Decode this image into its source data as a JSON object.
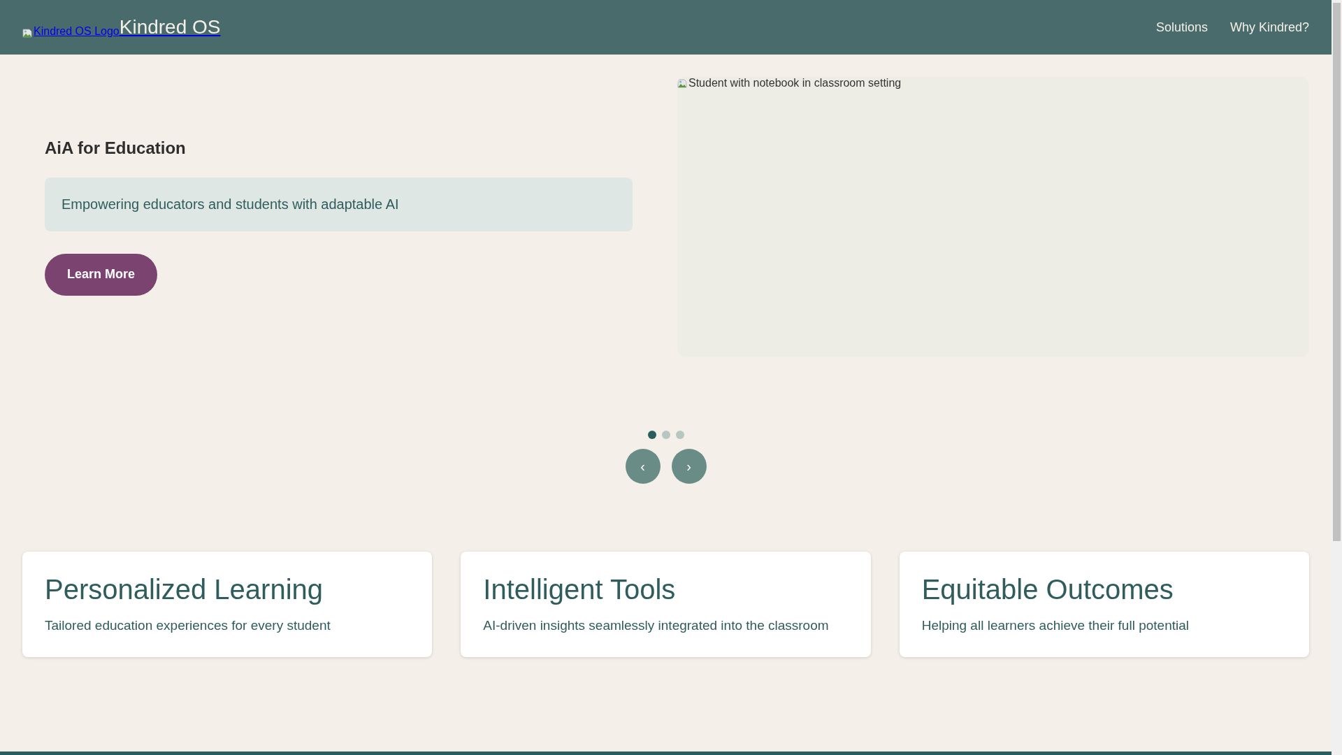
{
  "header": {
    "logo_alt": "Kindred OS Logo",
    "brand": "Kindred OS",
    "nav": [
      "Solutions",
      "Why Kindred?"
    ]
  },
  "hero": {
    "title": "AiA for Education",
    "subtitle": "Empowering educators and students with adaptable AI",
    "button": "Learn More",
    "image_alt": "Student with notebook in classroom setting"
  },
  "carousel": {
    "dots": [
      {
        "selected": true
      },
      {
        "selected": false
      },
      {
        "selected": false
      }
    ],
    "prev": "‹",
    "next": "›"
  },
  "features": [
    {
      "title": "Personalized Learning",
      "text": "Tailored education experiences for every student"
    },
    {
      "title": "Intelligent Tools",
      "text": "AI-driven insights seamlessly integrated into the classroom"
    },
    {
      "title": "Equitable Outcomes",
      "text": "Helping all learners achieve their full potential"
    }
  ]
}
